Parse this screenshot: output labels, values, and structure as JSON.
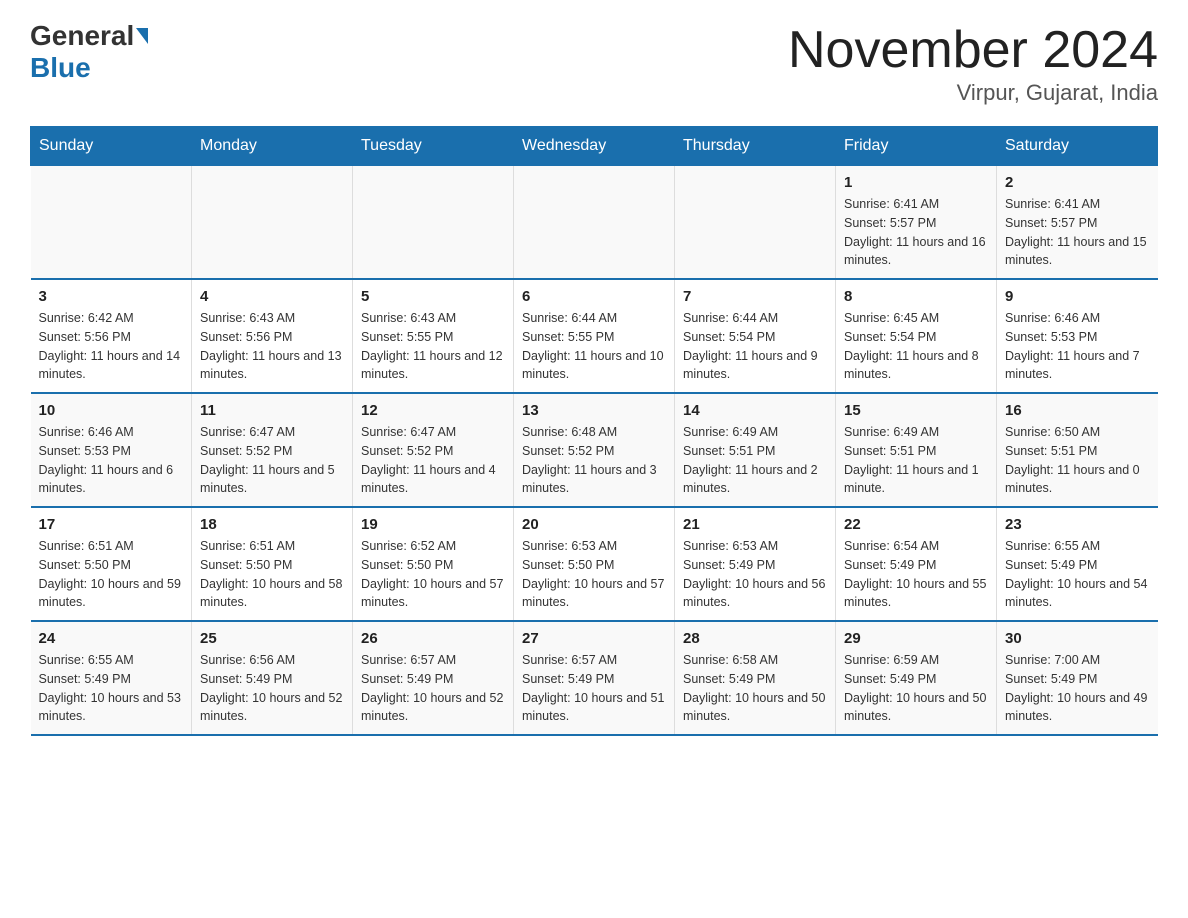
{
  "logo": {
    "part1": "General",
    "part2": "Blue"
  },
  "title": "November 2024",
  "subtitle": "Virpur, Gujarat, India",
  "days_of_week": [
    "Sunday",
    "Monday",
    "Tuesday",
    "Wednesday",
    "Thursday",
    "Friday",
    "Saturday"
  ],
  "weeks": [
    [
      {
        "num": "",
        "info": ""
      },
      {
        "num": "",
        "info": ""
      },
      {
        "num": "",
        "info": ""
      },
      {
        "num": "",
        "info": ""
      },
      {
        "num": "",
        "info": ""
      },
      {
        "num": "1",
        "info": "Sunrise: 6:41 AM\nSunset: 5:57 PM\nDaylight: 11 hours and 16 minutes."
      },
      {
        "num": "2",
        "info": "Sunrise: 6:41 AM\nSunset: 5:57 PM\nDaylight: 11 hours and 15 minutes."
      }
    ],
    [
      {
        "num": "3",
        "info": "Sunrise: 6:42 AM\nSunset: 5:56 PM\nDaylight: 11 hours and 14 minutes."
      },
      {
        "num": "4",
        "info": "Sunrise: 6:43 AM\nSunset: 5:56 PM\nDaylight: 11 hours and 13 minutes."
      },
      {
        "num": "5",
        "info": "Sunrise: 6:43 AM\nSunset: 5:55 PM\nDaylight: 11 hours and 12 minutes."
      },
      {
        "num": "6",
        "info": "Sunrise: 6:44 AM\nSunset: 5:55 PM\nDaylight: 11 hours and 10 minutes."
      },
      {
        "num": "7",
        "info": "Sunrise: 6:44 AM\nSunset: 5:54 PM\nDaylight: 11 hours and 9 minutes."
      },
      {
        "num": "8",
        "info": "Sunrise: 6:45 AM\nSunset: 5:54 PM\nDaylight: 11 hours and 8 minutes."
      },
      {
        "num": "9",
        "info": "Sunrise: 6:46 AM\nSunset: 5:53 PM\nDaylight: 11 hours and 7 minutes."
      }
    ],
    [
      {
        "num": "10",
        "info": "Sunrise: 6:46 AM\nSunset: 5:53 PM\nDaylight: 11 hours and 6 minutes."
      },
      {
        "num": "11",
        "info": "Sunrise: 6:47 AM\nSunset: 5:52 PM\nDaylight: 11 hours and 5 minutes."
      },
      {
        "num": "12",
        "info": "Sunrise: 6:47 AM\nSunset: 5:52 PM\nDaylight: 11 hours and 4 minutes."
      },
      {
        "num": "13",
        "info": "Sunrise: 6:48 AM\nSunset: 5:52 PM\nDaylight: 11 hours and 3 minutes."
      },
      {
        "num": "14",
        "info": "Sunrise: 6:49 AM\nSunset: 5:51 PM\nDaylight: 11 hours and 2 minutes."
      },
      {
        "num": "15",
        "info": "Sunrise: 6:49 AM\nSunset: 5:51 PM\nDaylight: 11 hours and 1 minute."
      },
      {
        "num": "16",
        "info": "Sunrise: 6:50 AM\nSunset: 5:51 PM\nDaylight: 11 hours and 0 minutes."
      }
    ],
    [
      {
        "num": "17",
        "info": "Sunrise: 6:51 AM\nSunset: 5:50 PM\nDaylight: 10 hours and 59 minutes."
      },
      {
        "num": "18",
        "info": "Sunrise: 6:51 AM\nSunset: 5:50 PM\nDaylight: 10 hours and 58 minutes."
      },
      {
        "num": "19",
        "info": "Sunrise: 6:52 AM\nSunset: 5:50 PM\nDaylight: 10 hours and 57 minutes."
      },
      {
        "num": "20",
        "info": "Sunrise: 6:53 AM\nSunset: 5:50 PM\nDaylight: 10 hours and 57 minutes."
      },
      {
        "num": "21",
        "info": "Sunrise: 6:53 AM\nSunset: 5:49 PM\nDaylight: 10 hours and 56 minutes."
      },
      {
        "num": "22",
        "info": "Sunrise: 6:54 AM\nSunset: 5:49 PM\nDaylight: 10 hours and 55 minutes."
      },
      {
        "num": "23",
        "info": "Sunrise: 6:55 AM\nSunset: 5:49 PM\nDaylight: 10 hours and 54 minutes."
      }
    ],
    [
      {
        "num": "24",
        "info": "Sunrise: 6:55 AM\nSunset: 5:49 PM\nDaylight: 10 hours and 53 minutes."
      },
      {
        "num": "25",
        "info": "Sunrise: 6:56 AM\nSunset: 5:49 PM\nDaylight: 10 hours and 52 minutes."
      },
      {
        "num": "26",
        "info": "Sunrise: 6:57 AM\nSunset: 5:49 PM\nDaylight: 10 hours and 52 minutes."
      },
      {
        "num": "27",
        "info": "Sunrise: 6:57 AM\nSunset: 5:49 PM\nDaylight: 10 hours and 51 minutes."
      },
      {
        "num": "28",
        "info": "Sunrise: 6:58 AM\nSunset: 5:49 PM\nDaylight: 10 hours and 50 minutes."
      },
      {
        "num": "29",
        "info": "Sunrise: 6:59 AM\nSunset: 5:49 PM\nDaylight: 10 hours and 50 minutes."
      },
      {
        "num": "30",
        "info": "Sunrise: 7:00 AM\nSunset: 5:49 PM\nDaylight: 10 hours and 49 minutes."
      }
    ]
  ]
}
